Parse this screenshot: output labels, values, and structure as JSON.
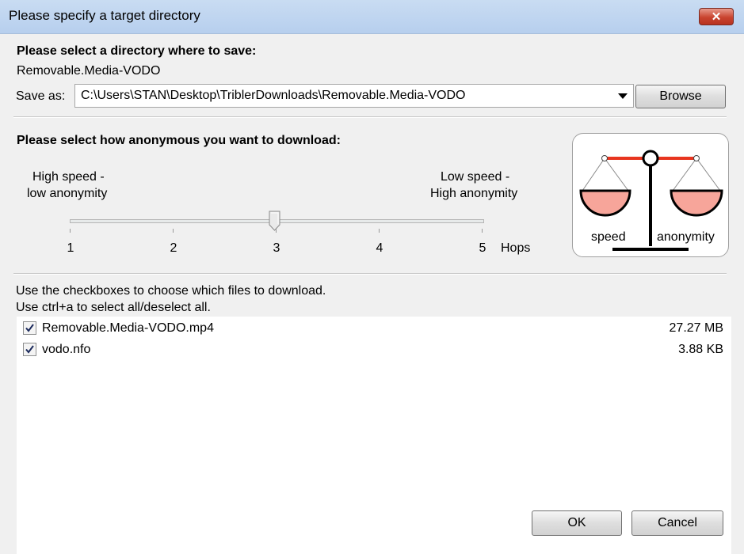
{
  "window": {
    "title": "Please specify a target directory",
    "close_label": "✕"
  },
  "directory": {
    "heading": "Please select a directory where to save:",
    "name": "Removable.Media-VODO",
    "save_as_label": "Save as:",
    "path": "C:\\Users\\STAN\\Desktop\\TriblerDownloads\\Removable.Media-VODO",
    "browse_label": "Browse"
  },
  "anonymity": {
    "heading": "Please select how anonymous you want to download:",
    "left_label_1": "High speed -",
    "left_label_2": "low anonymity",
    "right_label_1": "Low speed -",
    "right_label_2": "High anonymity",
    "ticks": [
      "1",
      "2",
      "3",
      "4",
      "5"
    ],
    "unit_label": "Hops",
    "selected_hops": 3,
    "scale_left_label": "speed",
    "scale_right_label": "anonymity"
  },
  "files": {
    "instruction_1": "Use the checkboxes to choose which files to download.",
    "instruction_2": "Use ctrl+a to select all/deselect all.",
    "items": [
      {
        "name": "Removable.Media-VODO.mp4",
        "size": "27.27 MB",
        "checked": true
      },
      {
        "name": "vodo.nfo",
        "size": "3.88 KB",
        "checked": true
      }
    ]
  },
  "buttons": {
    "ok_label": "OK",
    "cancel_label": "Cancel"
  },
  "colors": {
    "accent_red": "#e8351f",
    "pan_fill": "#f7a59a",
    "titlebar": "#c3d7f0"
  }
}
